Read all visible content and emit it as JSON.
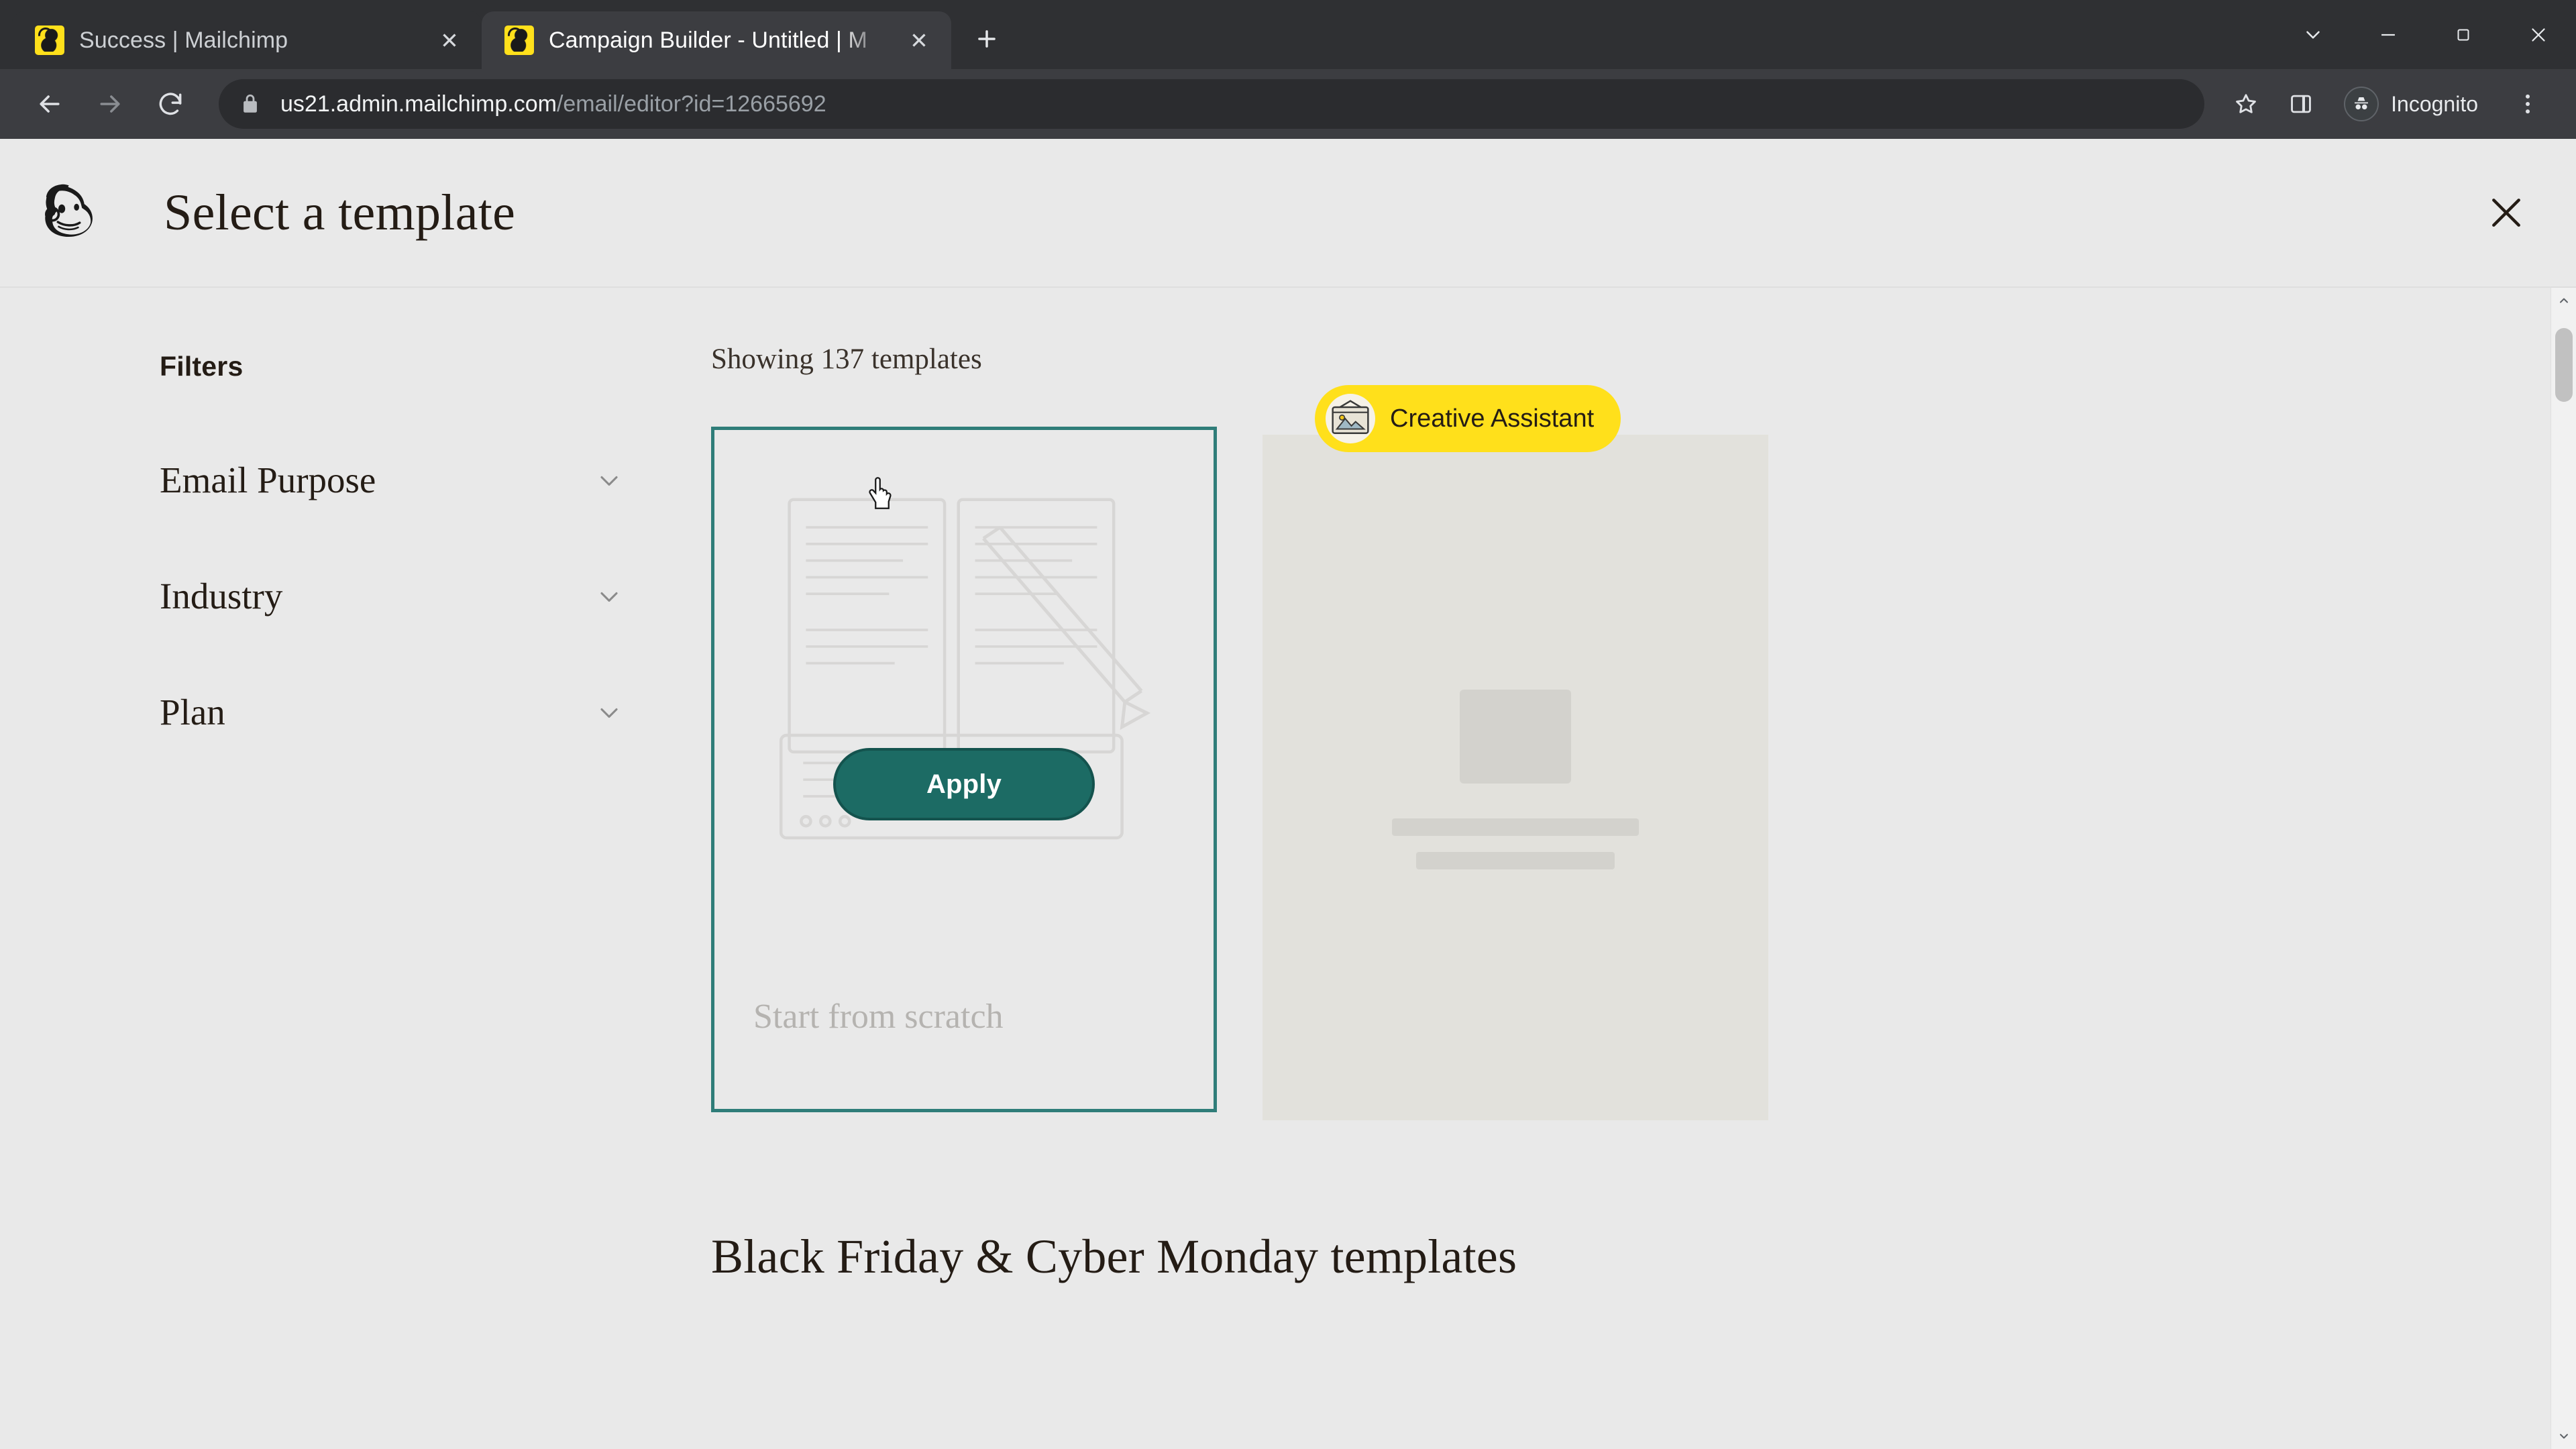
{
  "browser": {
    "tabs": [
      {
        "title": "Success | Mailchimp",
        "favicon": "mailchimp-favicon",
        "active": false
      },
      {
        "title": "Campaign Builder - Untitled | M",
        "favicon": "mailchimp-favicon",
        "active": true
      }
    ],
    "new_tab_label": "+",
    "close_glyph": "✕",
    "window_controls": {
      "minimize_extra": "chevron-down",
      "minimize": "–",
      "maximize": "❐",
      "close": "✕"
    },
    "toolbar": {
      "back": "back-arrow",
      "forward": "forward-arrow",
      "reload": "reload-arrow",
      "lock": "lock-icon",
      "url_host": "us21.admin.mailchimp.com",
      "url_path": "/email/editor?id=12665692",
      "bookmark": "star-icon",
      "side_panel": "side-panel-icon",
      "profile_label": "Incognito",
      "menu": "three-dot-menu"
    }
  },
  "page": {
    "logo": "mailchimp-freddie-logo",
    "title": "Select a template",
    "close_label": "✕",
    "sidebar": {
      "heading": "Filters",
      "filters": [
        {
          "label": "Email Purpose",
          "expanded": false
        },
        {
          "label": "Industry",
          "expanded": false
        },
        {
          "label": "Plan",
          "expanded": false
        }
      ]
    },
    "main": {
      "showing_text": "Showing 137 templates",
      "cards": [
        {
          "name": "start-from-scratch",
          "label": "Start from scratch",
          "selected": true,
          "apply_label": "Apply"
        },
        {
          "name": "creative-assistant",
          "badge_label": "Creative Assistant",
          "badge_icon": "creative-assistant-icon"
        }
      ],
      "section_heading": "Black Friday & Cyber Monday templates"
    },
    "scrollbar": {
      "position": "top"
    }
  },
  "colors": {
    "accent_teal": "#2f7d79",
    "button_teal": "#1c6b64",
    "brand_yellow": "#ffe01b",
    "page_bg": "#e9e9e9",
    "chrome_dark": "#3c3d41",
    "tabstrip_dark": "#2f3033"
  }
}
